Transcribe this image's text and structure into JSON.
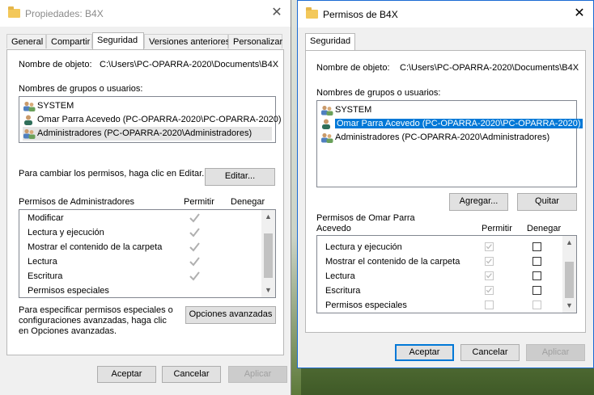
{
  "props_window": {
    "title": "Propiedades: B4X",
    "tabs": [
      "General",
      "Compartir",
      "Seguridad",
      "Versiones anteriores",
      "Personalizar"
    ],
    "object_name_label": "Nombre de objeto:",
    "object_name_value": "C:\\Users\\PC-OPARRA-2020\\Documents\\B4X",
    "groups_label": "Nombres de grupos o usuarios:",
    "groups": [
      "SYSTEM",
      "Omar Parra Acevedo (PC-OPARRA-2020\\PC-OPARRA-2020)",
      "Administradores (PC-OPARRA-2020\\Administradores)"
    ],
    "change_text": "Para cambiar los permisos, haga clic en Editar.",
    "edit_button": "Editar...",
    "perms_label": "Permisos de Administradores",
    "allow_header": "Permitir",
    "deny_header": "Denegar",
    "permissions": [
      "Modificar",
      "Lectura y ejecución",
      "Mostrar el contenido de la carpeta",
      "Lectura",
      "Escritura",
      "Permisos especiales"
    ],
    "special_text_1": "Para especificar permisos especiales o",
    "special_text_2": "configuraciones avanzadas, haga clic",
    "special_text_3": "en Opciones avanzadas.",
    "advanced_button": "Opciones avanzadas",
    "accept_button": "Aceptar",
    "cancel_button": "Cancelar",
    "apply_button": "Aplicar"
  },
  "perms_window": {
    "title": "Permisos de B4X",
    "tab": "Seguridad",
    "object_name_label": "Nombre de objeto:",
    "object_name_value": "C:\\Users\\PC-OPARRA-2020\\Documents\\B4X",
    "groups_label": "Nombres de grupos o usuarios:",
    "groups": [
      "SYSTEM",
      "Omar Parra Acevedo (PC-OPARRA-2020\\PC-OPARRA-2020)",
      "Administradores (PC-OPARRA-2020\\Administradores)"
    ],
    "add_button": "Agregar...",
    "remove_button": "Quitar",
    "perms_label_1": "Permisos de Omar Parra",
    "perms_label_2": "Acevedo",
    "allow_header": "Permitir",
    "deny_header": "Denegar",
    "permissions": [
      "Lectura y ejecución",
      "Mostrar el contenido de la carpeta",
      "Lectura",
      "Escritura",
      "Permisos especiales"
    ],
    "accept_button": "Aceptar",
    "cancel_button": "Cancelar",
    "apply_button": "Aplicar"
  },
  "colors": {
    "selection": "#0078d7",
    "folder": "#f3c85a"
  }
}
